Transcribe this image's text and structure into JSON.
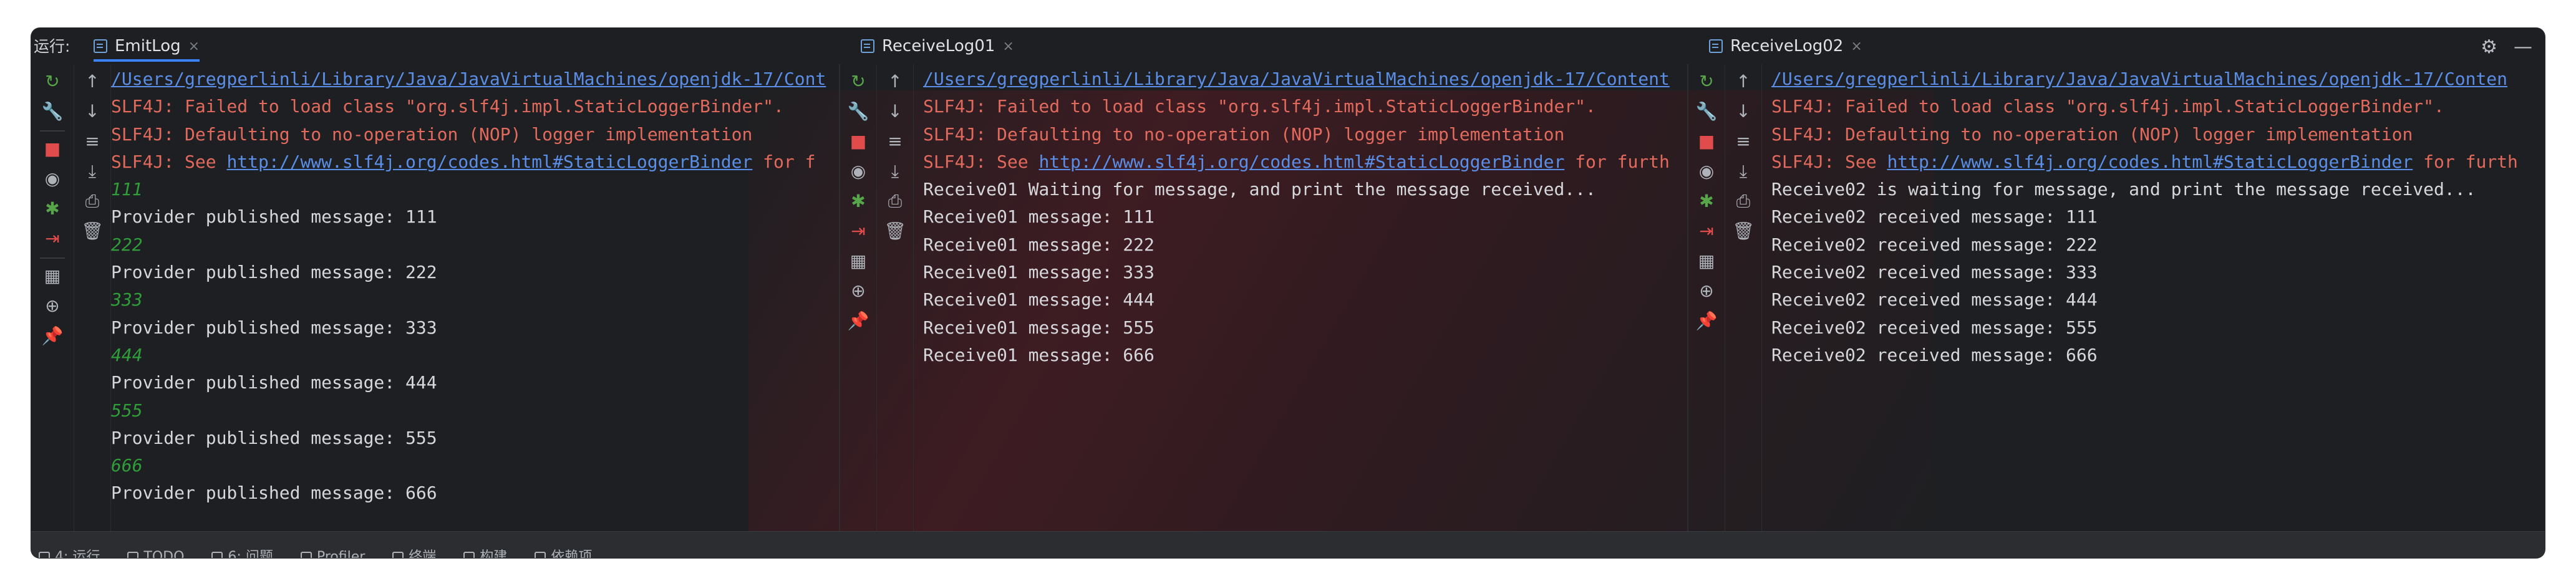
{
  "window": {
    "run_label": "运行:",
    "top_right": {
      "settings_icon": "gear-icon",
      "minimize_label": "—"
    }
  },
  "panes": [
    {
      "tab_label": "EmitLog",
      "lines": [
        {
          "text": "/Users/gregperlinli/Library/Java/JavaVirtualMachines/openjdk-17/Cont",
          "style": "path"
        },
        {
          "text": "SLF4J: Failed to load class \"org.slf4j.impl.StaticLoggerBinder\".",
          "style": "red"
        },
        {
          "text": "SLF4J: Defaulting to no-operation (NOP) logger implementation",
          "style": "red"
        },
        {
          "text": "SLF4J: See ",
          "style": "red",
          "link": "http://www.slf4j.org/codes.html#StaticLoggerBinder",
          "tail": " for f"
        },
        {
          "text": "111",
          "style": "green"
        },
        {
          "text": "Provider published message: 111",
          "style": "white"
        },
        {
          "text": "222",
          "style": "green"
        },
        {
          "text": "Provider published message: 222",
          "style": "white"
        },
        {
          "text": "333",
          "style": "green"
        },
        {
          "text": "Provider published message: 333",
          "style": "white"
        },
        {
          "text": "444",
          "style": "green"
        },
        {
          "text": "Provider published message: 444",
          "style": "white"
        },
        {
          "text": "555",
          "style": "green"
        },
        {
          "text": "Provider published message: 555",
          "style": "white"
        },
        {
          "text": "666",
          "style": "green"
        },
        {
          "text": "Provider published message: 666",
          "style": "white"
        }
      ]
    },
    {
      "tab_label": "ReceiveLog01",
      "lines": [
        {
          "text": "/Users/gregperlinli/Library/Java/JavaVirtualMachines/openjdk-17/Content",
          "style": "path"
        },
        {
          "text": "SLF4J: Failed to load class \"org.slf4j.impl.StaticLoggerBinder\".",
          "style": "red"
        },
        {
          "text": "SLF4J: Defaulting to no-operation (NOP) logger implementation",
          "style": "red"
        },
        {
          "text": "SLF4J: See ",
          "style": "red",
          "link": "http://www.slf4j.org/codes.html#StaticLoggerBinder",
          "tail": " for furth"
        },
        {
          "text": "Receive01 Waiting for message, and print the message received...",
          "style": "white"
        },
        {
          "text": "Receive01 message: 111",
          "style": "white"
        },
        {
          "text": "Receive01 message: 222",
          "style": "white"
        },
        {
          "text": "Receive01 message: 333",
          "style": "white"
        },
        {
          "text": "Receive01 message: 444",
          "style": "white"
        },
        {
          "text": "Receive01 message: 555",
          "style": "white"
        },
        {
          "text": "Receive01 message: 666",
          "style": "white"
        }
      ]
    },
    {
      "tab_label": "ReceiveLog02",
      "lines": [
        {
          "text": "/Users/gregperlinli/Library/Java/JavaVirtualMachines/openjdk-17/Conten",
          "style": "path"
        },
        {
          "text": "SLF4J: Failed to load class \"org.slf4j.impl.StaticLoggerBinder\".",
          "style": "red"
        },
        {
          "text": "SLF4J: Defaulting to no-operation (NOP) logger implementation",
          "style": "red"
        },
        {
          "text": "SLF4J: See ",
          "style": "red",
          "link": "http://www.slf4j.org/codes.html#StaticLoggerBinder",
          "tail": " for furth"
        },
        {
          "text": "Receive02 is waiting for message, and print the message received...",
          "style": "white"
        },
        {
          "text": "Receive02 received message: 111",
          "style": "white"
        },
        {
          "text": "Receive02 received message: 222",
          "style": "white"
        },
        {
          "text": "Receive02 received message: 333",
          "style": "white"
        },
        {
          "text": "Receive02 received message: 444",
          "style": "white"
        },
        {
          "text": "Receive02 received message: 555",
          "style": "white"
        },
        {
          "text": "Receive02 received message: 666",
          "style": "white"
        }
      ]
    }
  ],
  "toolbar_icons": [
    "rerun-icon",
    "arrow-up-icon",
    "arrow-down-icon",
    "settings-wrench-icon",
    "soft-wrap-icon",
    "stop-icon",
    "scroll-to-end-icon",
    "screenshot-icon",
    "print-icon",
    "debug-icon",
    "trash-icon",
    "exit-icon",
    "layout-icon",
    "globe-icon",
    "pin-icon"
  ],
  "statusbar": {
    "items": [
      "4: 运行",
      "TODO",
      "6: 问题",
      "Profiler",
      "终端",
      "构建",
      "依赖项"
    ]
  },
  "colors": {
    "background": "#1e1f22",
    "error_red": "#e26a5d",
    "link_blue": "#5b8ee6",
    "output_green": "#2f9e3a",
    "text": "#d5d7db"
  }
}
